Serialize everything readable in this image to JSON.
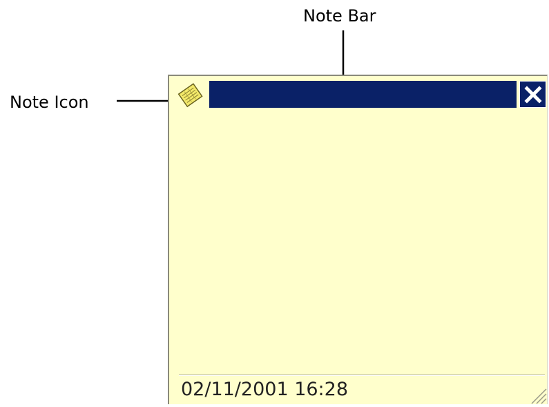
{
  "annotations": {
    "note_bar": "Note Bar",
    "note_icon": "Note Icon"
  },
  "note": {
    "timestamp": "02/11/2001 16:28",
    "background_color": "#ffffcc",
    "bar_color": "#0a2167",
    "icon": "note-icon",
    "close_icon": "close-icon",
    "resize_icon": "resize-grip-icon"
  }
}
